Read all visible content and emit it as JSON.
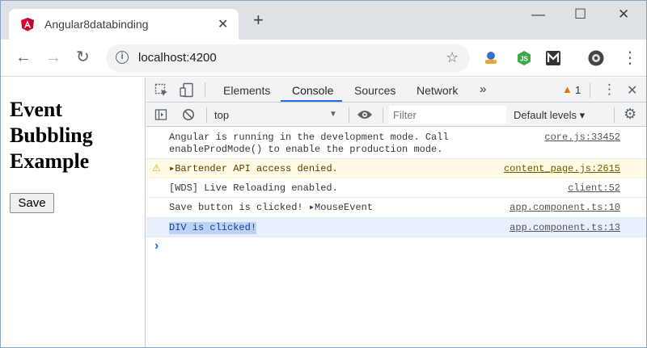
{
  "browser": {
    "tab_title": "Angular8databinding",
    "tab_close": "✕",
    "new_tab": "+",
    "url": "localhost:4200",
    "window_controls": {
      "minimize": "—",
      "maximize": "☐",
      "close": "✕"
    },
    "nav": {
      "back": "←",
      "forward": "→",
      "reload": "↻"
    },
    "bookmark_icon": "☆",
    "menu_icon": "⋮",
    "extensions": [
      {
        "name": "cloud-extension-icon",
        "color": "#3f6fc9"
      },
      {
        "name": "nodejs-extension-icon",
        "color": "#3fa84b"
      },
      {
        "name": "m-extension-icon",
        "color": "#333333"
      },
      {
        "name": "profile-avatar-icon",
        "color": "#444444"
      }
    ]
  },
  "page": {
    "heading": "Event Bubbling Example",
    "save_label": "Save"
  },
  "devtools": {
    "tabs": [
      "Elements",
      "Console",
      "Sources",
      "Network",
      "»"
    ],
    "active_tab": "Console",
    "warning_count": "1",
    "context": "top",
    "filter_placeholder": "Filter",
    "levels": "Default levels ▾",
    "messages": [
      {
        "type": "info",
        "text": "Angular is running in the development mode. Call\nenableProdMode() to enable the production mode.",
        "source": "core.js:33452"
      },
      {
        "type": "warning",
        "text": "▸Bartender API access denied.",
        "source": "content_page.js:2615"
      },
      {
        "type": "info",
        "text": "[WDS] Live Reloading enabled.",
        "source": "client:52"
      },
      {
        "type": "info",
        "text": "Save button is clicked! ▸MouseEvent",
        "source": "app.component.ts:10"
      },
      {
        "type": "selected",
        "text": "DIV is clicked!",
        "source": "app.component.ts:13"
      }
    ],
    "prompt": "›"
  },
  "colors": {
    "accent": "#1a73e8",
    "warning_bg": "#fffbe5",
    "angular_red": "#dd0031"
  }
}
